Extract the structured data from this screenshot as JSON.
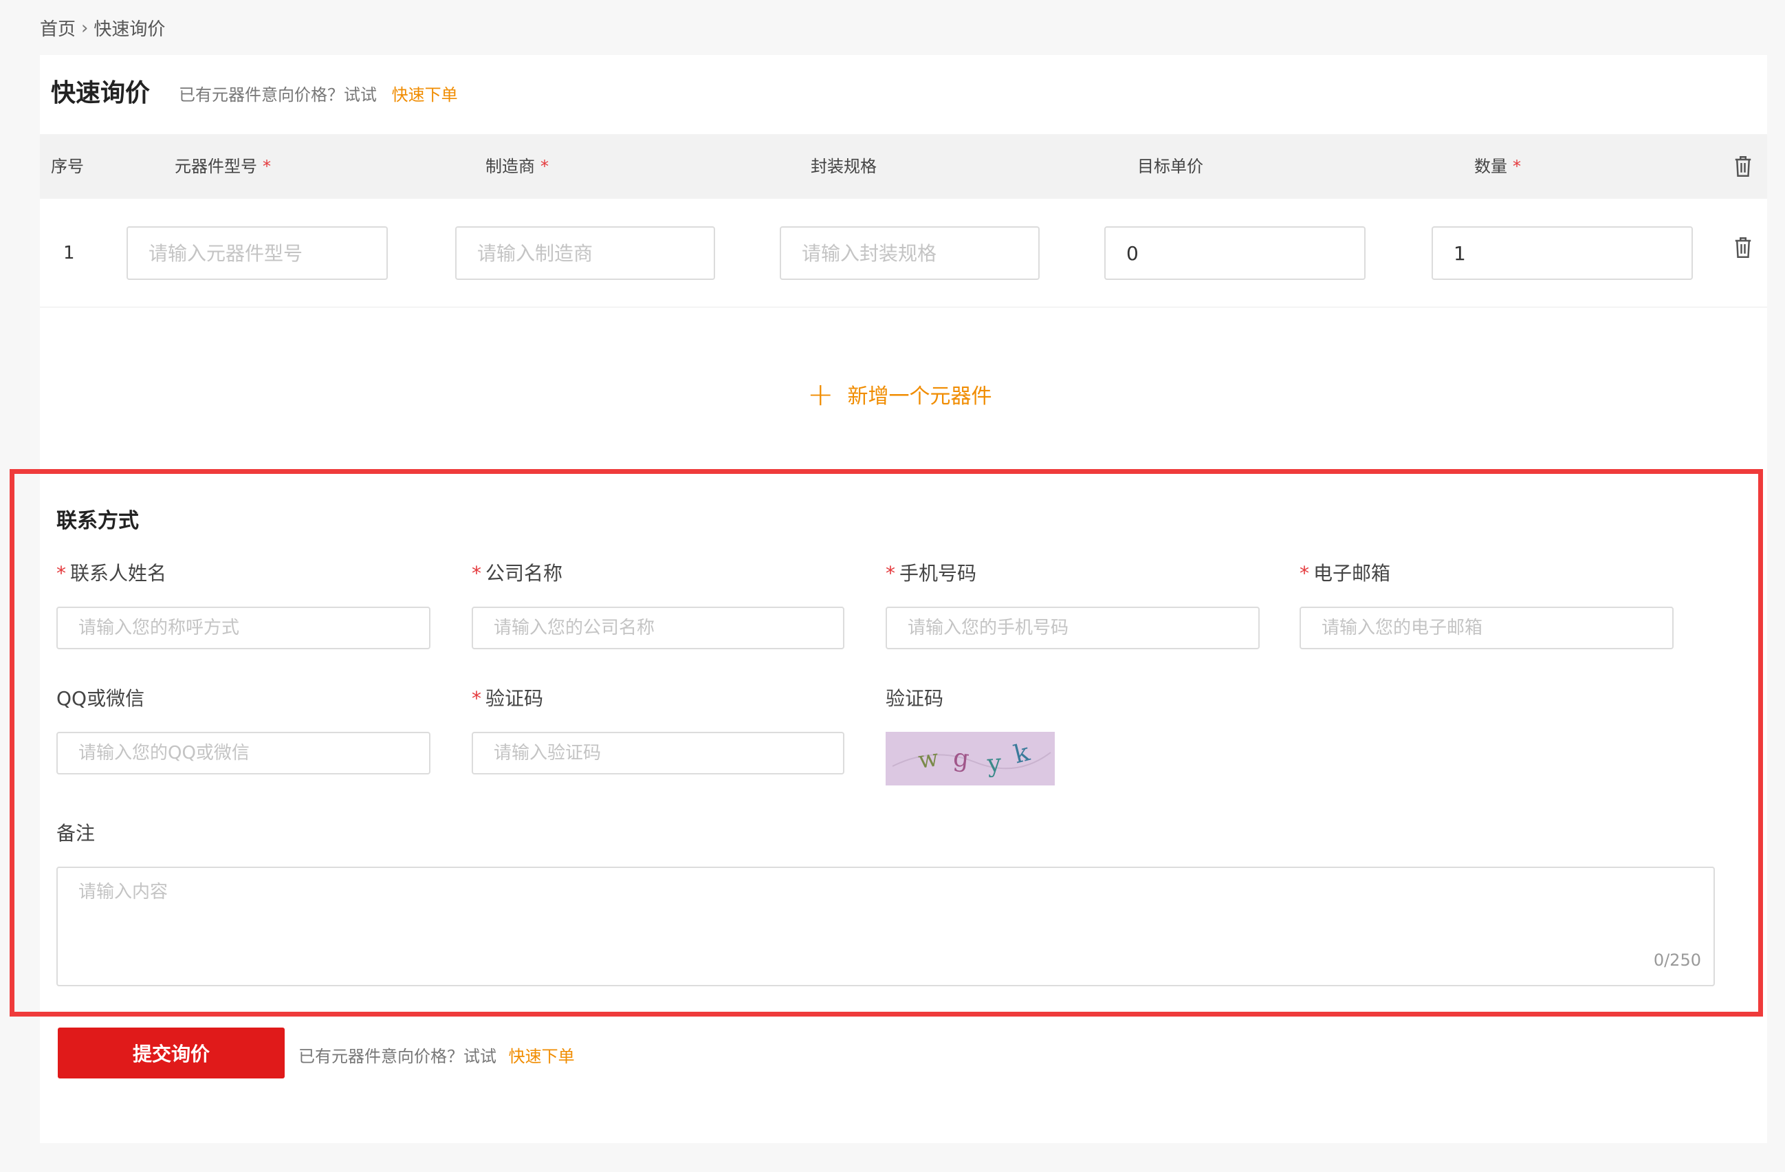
{
  "breadcrumb": {
    "home": "首页",
    "separator": "›",
    "current": "快速询价"
  },
  "header": {
    "title": "快速询价",
    "tip": "已有元器件意向价格？试试",
    "link": "快速下单"
  },
  "table": {
    "columns": [
      {
        "label": "序号",
        "required": false
      },
      {
        "label": "元器件型号",
        "required": true
      },
      {
        "label": "制造商",
        "required": true
      },
      {
        "label": "封装规格",
        "required": false
      },
      {
        "label": "目标单价",
        "required": false
      },
      {
        "label": "数量",
        "required": true
      }
    ],
    "required_mark": "*",
    "header_delete_icon": "trash-icon",
    "rows": [
      {
        "index": "1",
        "part_placeholder": "请输入元器件型号",
        "part_value": "",
        "maker_placeholder": "请输入制造商",
        "maker_value": "",
        "package_placeholder": "请输入封装规格",
        "package_value": "",
        "price_value": "0",
        "qty_value": "1"
      }
    ]
  },
  "add_button": {
    "icon": "plus-icon",
    "label": "新增一个元器件"
  },
  "contact": {
    "title": "联系方式",
    "required_mark": "*",
    "fields": {
      "name": {
        "label": "联系人姓名",
        "placeholder": "请输入您的称呼方式",
        "required": true
      },
      "company": {
        "label": "公司名称",
        "placeholder": "请输入您的公司名称",
        "required": true
      },
      "phone": {
        "label": "手机号码",
        "placeholder": "请输入您的手机号码",
        "required": true
      },
      "email": {
        "label": "电子邮箱",
        "placeholder": "请输入您的电子邮箱",
        "required": true
      },
      "qq": {
        "label": "QQ或微信",
        "placeholder": "请输入您的QQ或微信",
        "required": false
      },
      "code": {
        "label": "验证码",
        "placeholder": "请输入验证码",
        "required": true
      },
      "captcha": {
        "label": "验证码",
        "text": "wgyk"
      },
      "remark": {
        "label": "备注",
        "placeholder": "请输入内容",
        "counter": "0/250"
      }
    }
  },
  "footer": {
    "submit": "提交询价",
    "tip": "已有元器件意向价格？试试",
    "link": "快速下单"
  },
  "colors": {
    "accent": "#f08c00",
    "submit": "#e01a1a",
    "required": "#e4393c",
    "highlight": "#ef3b3b"
  }
}
